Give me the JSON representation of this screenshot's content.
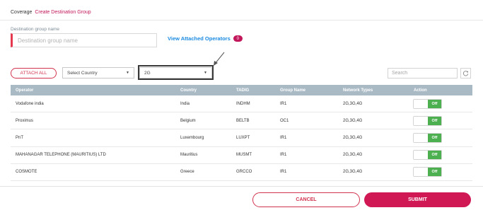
{
  "breadcrumb": {
    "parent": "Coverage",
    "current": "Create Destination Group"
  },
  "form": {
    "destination_label": "Destination group name",
    "destination_placeholder": "Destination group name",
    "destination_value": ""
  },
  "attached": {
    "link_label": "View Attached Operators",
    "count": "0"
  },
  "toolbar": {
    "attach_all_label": "ATTACH ALL",
    "country_selected": "Select Country",
    "network_selected": "2G",
    "search_placeholder": "Search"
  },
  "table": {
    "columns": [
      "Operator",
      "Country",
      "TADIG",
      "Group Name",
      "Network Types",
      "Action"
    ],
    "rows": [
      {
        "operator": "Vodafone india",
        "country": "India",
        "tadig": "INDHM",
        "group": "IR1",
        "network": "2G,3G,4G",
        "action": "Off"
      },
      {
        "operator": "Proximus",
        "country": "Belgium",
        "tadig": "BELTB",
        "group": "OC1",
        "network": "2G,3G,4G",
        "action": "Off"
      },
      {
        "operator": "PnT",
        "country": "Luxembourg",
        "tadig": "LUXPT",
        "group": "IR1",
        "network": "2G,3G,4G",
        "action": "Off"
      },
      {
        "operator": "MAHANAGAR TELEPHONE (MAURITIUS) LTD",
        "country": "Mauritius",
        "tadig": "MUSMT",
        "group": "IR1",
        "network": "2G,3G,4G",
        "action": "Off"
      },
      {
        "operator": "COSMOTE",
        "country": "Greece",
        "tadig": "GRCCO",
        "group": "IR1",
        "network": "2G,3G,4G",
        "action": "Off"
      }
    ]
  },
  "footer": {
    "cancel_label": "CANCEL",
    "submit_label": "SUBMIT"
  },
  "colors": {
    "accent": "#d01854",
    "link": "#1a8ae0",
    "toggle_on": "#4caf50",
    "table_header": "#a9bac5"
  },
  "icons": {
    "refresh": "refresh-icon",
    "caret": "chevron-down-icon",
    "annotation": "arrow-icon"
  }
}
